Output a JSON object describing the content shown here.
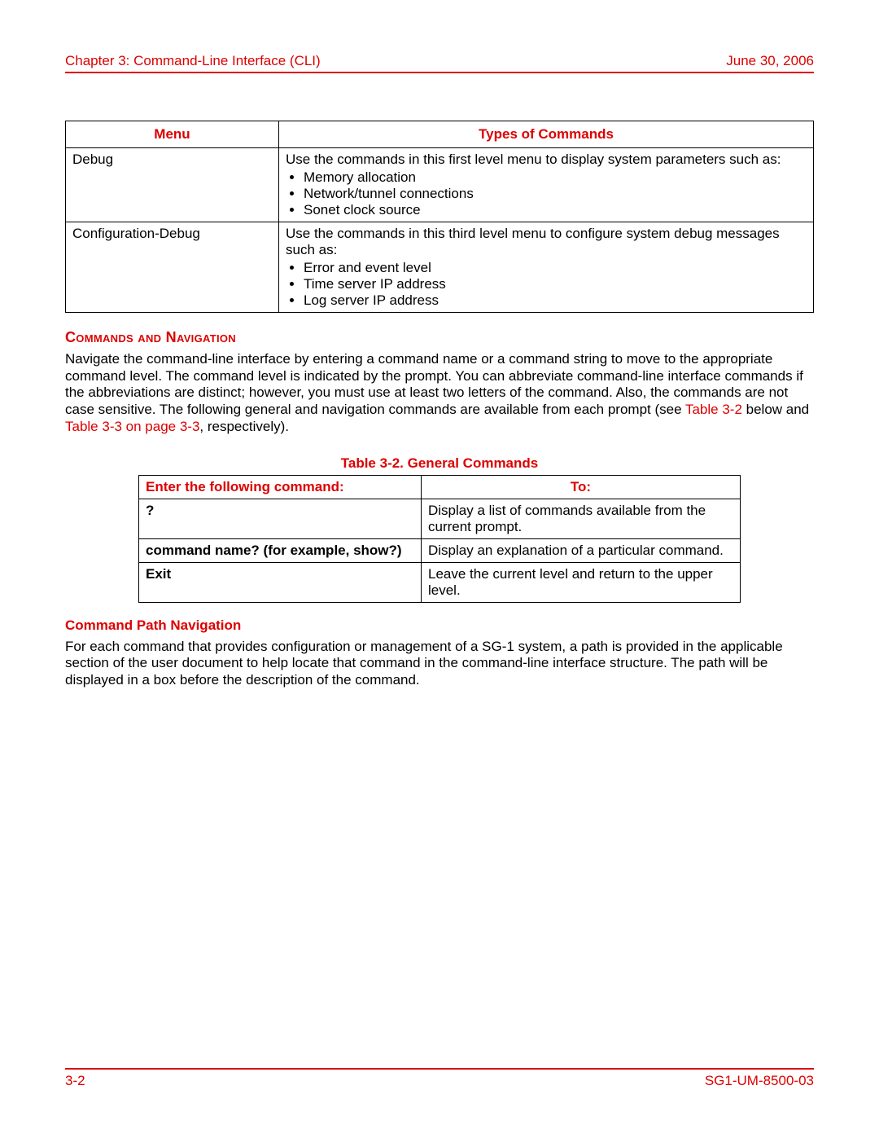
{
  "header": {
    "chapter": "Chapter 3: Command-Line Interface (CLI)",
    "date": "June 30, 2006"
  },
  "table1": {
    "headers": {
      "menu": "Menu",
      "types": "Types of Commands"
    },
    "rows": [
      {
        "menu": "Debug",
        "intro": "Use the commands in this first level menu to display system parameters such as:",
        "bullets": [
          "Memory allocation",
          "Network/tunnel connections",
          "Sonet clock source"
        ]
      },
      {
        "menu": "Configuration-Debug",
        "intro": "Use the commands in this third level menu to configure system debug messages such as:",
        "bullets": [
          "Error and event level",
          "Time server IP address",
          "Log server IP address"
        ]
      }
    ]
  },
  "section": {
    "heading": "Commands and Navigation",
    "para_pre": "Navigate the command-line interface by entering a command name or a command string to move to the appropriate command level. The command level is indicated by the prompt. You can abbreviate command-line interface commands if the abbreviations are distinct; however, you must use at least two letters of the command. Also, the commands are not case sensitive. The following general and navigation commands are available from each prompt (see ",
    "ref1": "Table 3-2",
    "para_mid": " below and ",
    "ref2": "Table 3-3 on page 3-3",
    "para_post": ", respectively)."
  },
  "table2": {
    "caption": "Table 3-2. General Commands",
    "headers": {
      "cmd": "Enter the following command:",
      "to": "To:"
    },
    "rows": [
      {
        "cmd": "?",
        "to": "Display a list of commands available from the current prompt."
      },
      {
        "cmd": "command name? (for example, show?)",
        "to": "Display an explanation of a particular command."
      },
      {
        "cmd": "Exit",
        "to": "Leave the current level and return to the upper level."
      }
    ]
  },
  "subsection": {
    "heading": "Command Path Navigation",
    "body": "For each command that provides configuration or management of a SG-1 system, a path is provided in the applicable section of the user document to help locate that command in the command-line interface structure. The path will be displayed in a box before the description of the command."
  },
  "footer": {
    "page": "3-2",
    "docid": "SG1-UM-8500-03"
  }
}
